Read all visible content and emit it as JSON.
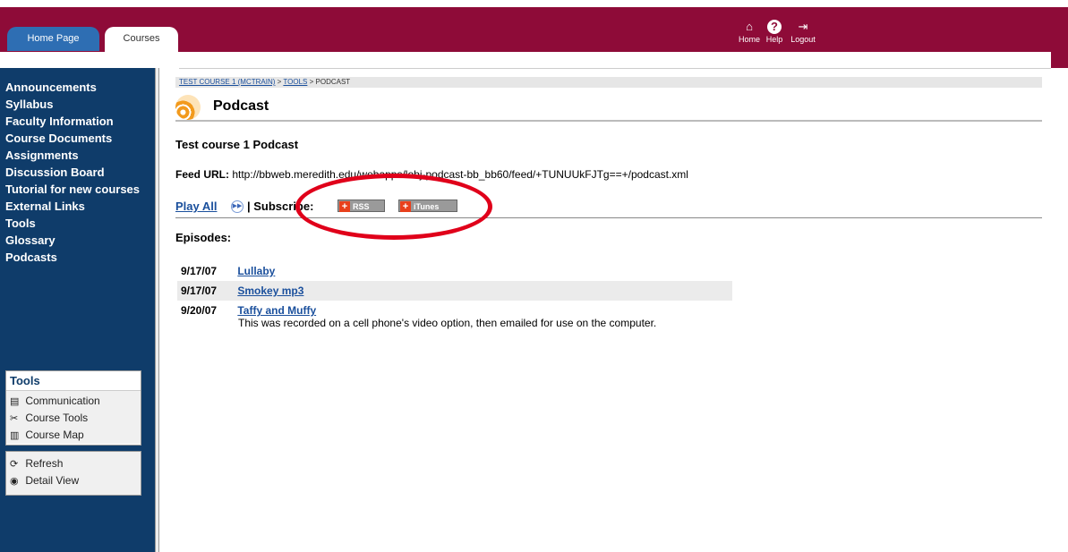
{
  "header": {
    "tabs": [
      {
        "label": "Home Page"
      },
      {
        "label": "Courses"
      }
    ],
    "nav": [
      {
        "label": "Home",
        "icon": "home-icon"
      },
      {
        "label": "Help",
        "icon": "help-icon"
      },
      {
        "label": "Logout",
        "icon": "logout-icon"
      }
    ]
  },
  "sidebar": {
    "items": [
      "Announcements",
      "Syllabus",
      "Faculty Information",
      "Course Documents",
      "Assignments",
      "Discussion Board",
      "Tutorial for new courses",
      "External Links",
      "Tools",
      "Glossary",
      "Podcasts"
    ],
    "tools_box": {
      "title": "Tools",
      "items": [
        "Communication",
        "Course Tools",
        "Course Map"
      ]
    },
    "actions_box": {
      "items": [
        "Refresh",
        "Detail View"
      ]
    }
  },
  "breadcrumb": {
    "course": "TEST COURSE 1 (MCTRAIN)",
    "sep1": " > ",
    "tools": "TOOLS",
    "sep2": " > ",
    "current": "PODCAST"
  },
  "page": {
    "title": "Podcast",
    "podcast_title": "Test course 1 Podcast",
    "feed_label": "Feed URL:",
    "feed_url": "http://bbweb.meredith.edu/webapps/lobj-podcast-bb_bb60/feed/+TUNUUkFJTg==+/podcast.xml",
    "play_all": "Play All",
    "subscribe_label": "| Subscribe:",
    "rss_label": "RSS",
    "itunes_label": "iTunes",
    "episodes_heading": "Episodes:"
  },
  "episodes": [
    {
      "date": "9/17/07",
      "title": "Lullaby",
      "desc": ""
    },
    {
      "date": "9/17/07",
      "title": "Smokey mp3",
      "desc": ""
    },
    {
      "date": "9/20/07",
      "title": "Taffy and Muffy",
      "desc": "This was recorded on a cell phone's video option, then emailed for use on the computer."
    }
  ],
  "colors": {
    "header": "#8e0b38",
    "sidebar": "#0f3c6a",
    "link": "#1a4f9c",
    "highlight_ellipse": "#e0001a"
  }
}
